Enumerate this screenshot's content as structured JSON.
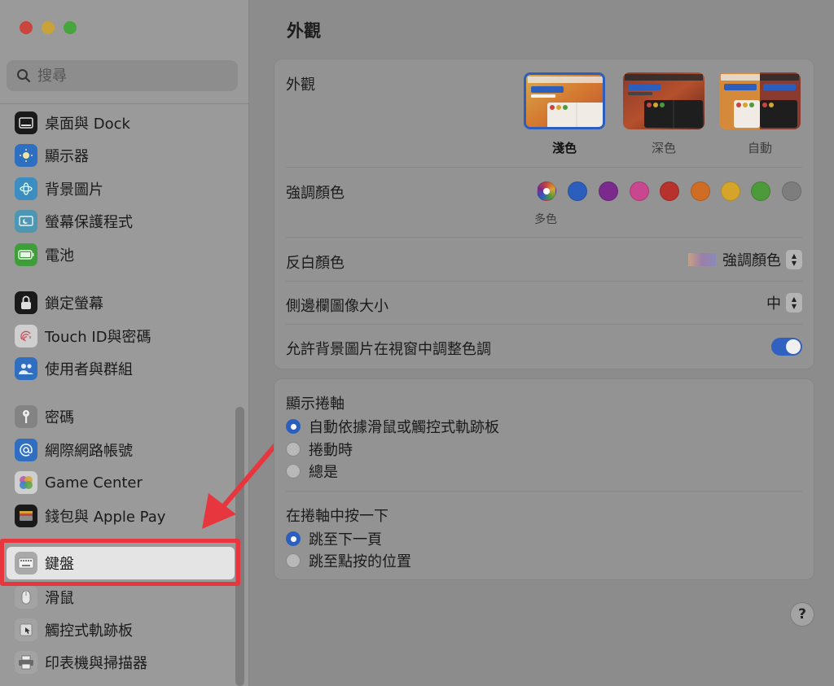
{
  "sidebar": {
    "search_placeholder": "搜尋",
    "items": [
      {
        "label": "桌面與 Dock",
        "icon": "dock-icon"
      },
      {
        "label": "顯示器",
        "icon": "display-icon"
      },
      {
        "label": "背景圖片",
        "icon": "wallpaper-icon"
      },
      {
        "label": "螢幕保護程式",
        "icon": "screensaver-icon"
      },
      {
        "label": "電池",
        "icon": "battery-icon"
      },
      {
        "label": "鎖定螢幕",
        "icon": "lock-icon"
      },
      {
        "label": "Touch ID與密碼",
        "icon": "fingerprint-icon"
      },
      {
        "label": "使用者與群組",
        "icon": "users-icon"
      },
      {
        "label": "密碼",
        "icon": "key-icon"
      },
      {
        "label": "網際網路帳號",
        "icon": "at-icon"
      },
      {
        "label": "Game Center",
        "icon": "game-center-icon"
      },
      {
        "label": "錢包與 Apple Pay",
        "icon": "wallet-icon"
      },
      {
        "label": "鍵盤",
        "icon": "keyboard-icon",
        "selected": true
      },
      {
        "label": "滑鼠",
        "icon": "mouse-icon"
      },
      {
        "label": "觸控式軌跡板",
        "icon": "trackpad-icon"
      },
      {
        "label": "印表機與掃描器",
        "icon": "printer-icon"
      }
    ]
  },
  "main": {
    "title": "外觀",
    "appearance": {
      "label": "外觀",
      "options": [
        {
          "label": "淺色",
          "selected": true
        },
        {
          "label": "深色"
        },
        {
          "label": "自動"
        }
      ]
    },
    "accent": {
      "label": "強調顏色",
      "selected_label": "多色",
      "colors": [
        "multicolor",
        "#2c5fbd",
        "#7a2a8c",
        "#c8478e",
        "#b8322d",
        "#cf6d24",
        "#d4a52a",
        "#4d9a3a",
        "#7d7d7d"
      ]
    },
    "highlight": {
      "label": "反白顏色",
      "value": "強調顏色"
    },
    "sidebar_icon_size": {
      "label": "側邊欄圖像大小",
      "value": "中"
    },
    "wallpaper_tint": {
      "label": "允許背景圖片在視窗中調整色調",
      "enabled": true
    },
    "scrollbars": {
      "label": "顯示捲軸",
      "options": [
        {
          "label": "自動依據滑鼠或觸控式軌跡板",
          "selected": true
        },
        {
          "label": "捲動時",
          "selected": false
        },
        {
          "label": "總是",
          "selected": false
        }
      ]
    },
    "click_scrollbar": {
      "label": "在捲軸中按一下",
      "options": [
        {
          "label": "跳至下一頁",
          "selected": true
        },
        {
          "label": "跳至點按的位置",
          "selected": false
        }
      ]
    },
    "help_label": "?"
  },
  "colors": {
    "accent_blue": "#2c5fbd",
    "annotation_red": "#e8363f",
    "close": "#c9453d",
    "minimize": "#c9a23a",
    "zoom": "#46a53c"
  }
}
